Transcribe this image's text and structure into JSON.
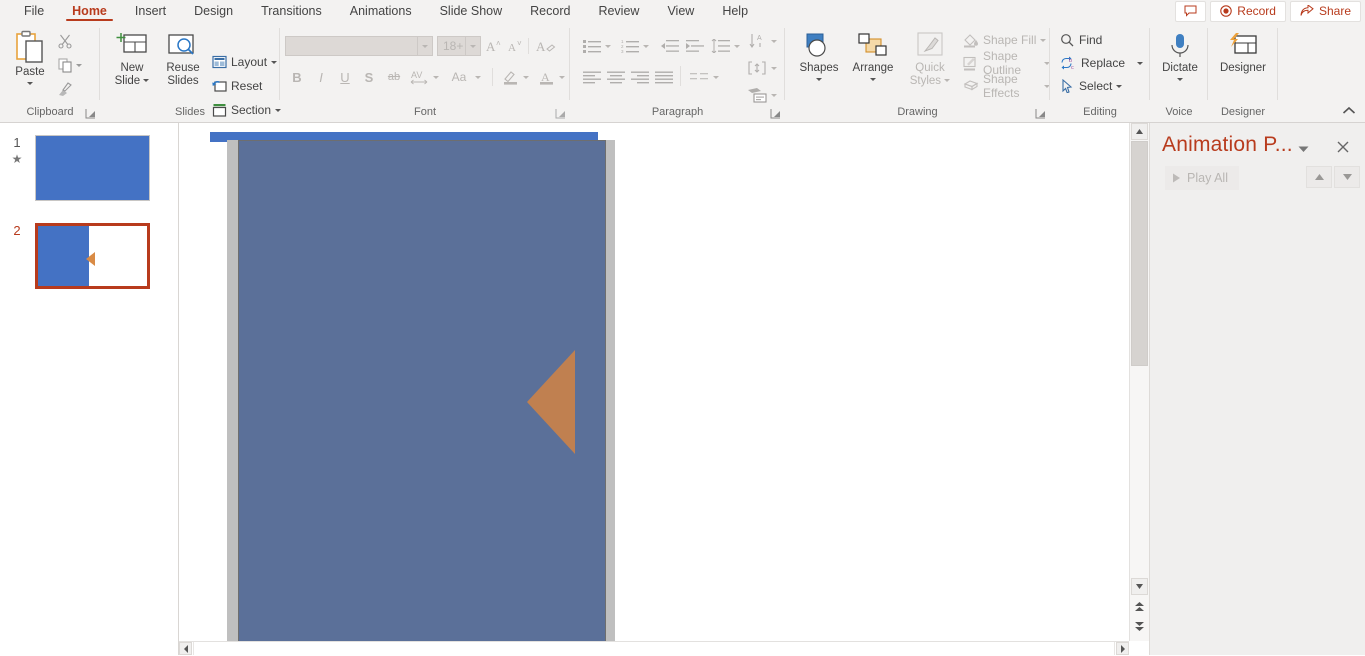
{
  "app": {
    "ribbon_tabs": [
      {
        "label": "File",
        "active": false
      },
      {
        "label": "Home",
        "active": true
      },
      {
        "label": "Insert",
        "active": false
      },
      {
        "label": "Design",
        "active": false
      },
      {
        "label": "Transitions",
        "active": false
      },
      {
        "label": "Animations",
        "active": false
      },
      {
        "label": "Slide Show",
        "active": false
      },
      {
        "label": "Record",
        "active": false
      },
      {
        "label": "Review",
        "active": false
      },
      {
        "label": "View",
        "active": false
      },
      {
        "label": "Help",
        "active": false
      }
    ],
    "window_buttons": {
      "comments_icon": "comment-icon",
      "record_label": "Record",
      "record_icon": "record-circle-icon",
      "share_label": "Share",
      "share_icon": "share-icon"
    },
    "collapse_ribbon_icon": "chevron-up-icon"
  },
  "ribbon": {
    "clipboard": {
      "group_label": "Clipboard",
      "paste_label": "Paste",
      "paste_icon": "clipboard-icon",
      "cut_label": "Cut",
      "cut_icon": "scissors-icon",
      "copy_label": "Copy",
      "copy_icon": "copy-icon",
      "format_painter_label": "Format Painter",
      "format_painter_icon": "paintbrush-icon",
      "dialog_launcher_icon": "dialog-launcher-icon"
    },
    "slides": {
      "group_label": "Slides",
      "new_slide_label": "New Slide",
      "new_slide_icon": "new-slide-icon",
      "reuse_slides_label": "Reuse Slides",
      "reuse_slides_icon": "reuse-slides-icon",
      "layout_label": "Layout",
      "layout_icon": "layout-icon",
      "reset_label": "Reset",
      "reset_icon": "reset-icon",
      "section_label": "Section",
      "section_icon": "section-icon"
    },
    "font": {
      "group_label": "Font",
      "font_name_value": "",
      "font_name_placeholder": "",
      "font_size_value": "18+",
      "grow_font_icon": "grow-font-icon",
      "shrink_font_icon": "shrink-font-icon",
      "clear_formatting_icon": "clear-formatting-icon",
      "bold_label": "B",
      "italic_label": "I",
      "underline_label": "U",
      "shadow_label": "S",
      "strikethrough_label": "ab",
      "character_spacing_icon": "character-spacing-icon",
      "change_case_label": "Aa",
      "text_highlight_icon": "text-highlight-icon",
      "font_color_icon": "font-color-icon",
      "dialog_launcher_icon": "dialog-launcher-icon"
    },
    "paragraph": {
      "group_label": "Paragraph",
      "bullets_icon": "bullets-icon",
      "numbering_icon": "numbering-icon",
      "decrease_indent_icon": "decrease-indent-icon",
      "increase_indent_icon": "increase-indent-icon",
      "line_spacing_icon": "line-spacing-icon",
      "text_direction_icon": "text-direction-icon",
      "align_text_icon": "align-text-icon",
      "convert_smartart_icon": "smartart-icon",
      "align_left_icon": "align-left-icon",
      "align_center_icon": "align-center-icon",
      "align_right_icon": "align-right-icon",
      "justify_icon": "justify-icon",
      "columns_icon": "columns-icon",
      "dialog_launcher_icon": "dialog-launcher-icon"
    },
    "drawing": {
      "group_label": "Drawing",
      "shapes_label": "Shapes",
      "shapes_icon": "shapes-icon",
      "arrange_label": "Arrange",
      "arrange_icon": "arrange-icon",
      "quick_styles_label": "Quick Styles",
      "quick_styles_icon": "quick-styles-icon",
      "shape_fill_label": "Shape Fill",
      "shape_fill_icon": "fill-bucket-icon",
      "shape_outline_label": "Shape Outline",
      "shape_outline_icon": "shape-outline-icon",
      "shape_effects_label": "Shape Effects",
      "shape_effects_icon": "shape-effects-icon",
      "dialog_launcher_icon": "dialog-launcher-icon"
    },
    "editing": {
      "group_label": "Editing",
      "find_label": "Find",
      "find_icon": "search-icon",
      "replace_label": "Replace",
      "replace_icon": "replace-icon",
      "select_label": "Select",
      "select_icon": "cursor-arrow-icon"
    },
    "voice": {
      "group_label": "Voice",
      "dictate_label": "Dictate",
      "dictate_icon": "microphone-icon"
    },
    "designer": {
      "group_label": "Designer",
      "designer_label": "Designer",
      "designer_icon": "designer-icon"
    }
  },
  "thumbnails": {
    "slides": [
      {
        "number": "1",
        "selected": false,
        "has_animation": true,
        "animation_marker": "★"
      },
      {
        "number": "2",
        "selected": true,
        "has_animation": false,
        "animation_marker": ""
      }
    ]
  },
  "slide_canvas": {
    "background_color": "#ffffff",
    "top_band_color": "#4472c4",
    "shape_fill_color": "#5b7099",
    "shape_border_color": "#7f7f7f",
    "selection_handle_color": "#bfbfbf",
    "triangle_color": "#c08050"
  },
  "scrollbars": {
    "v_up_icon": "scroll-up-icon",
    "v_down_icon": "scroll-down-icon",
    "prev_slide_icon": "previous-slide-icon",
    "next_slide_icon": "next-slide-icon",
    "h_left_icon": "scroll-left-icon",
    "h_right_icon": "scroll-right-icon"
  },
  "animation_pane": {
    "title": "Animation P...",
    "caret_icon": "chevron-down-icon",
    "close_icon": "close-icon",
    "play_all_label": "Play All",
    "play_icon": "play-icon",
    "move_up_icon": "move-up-icon",
    "move_down_icon": "move-down-icon"
  }
}
